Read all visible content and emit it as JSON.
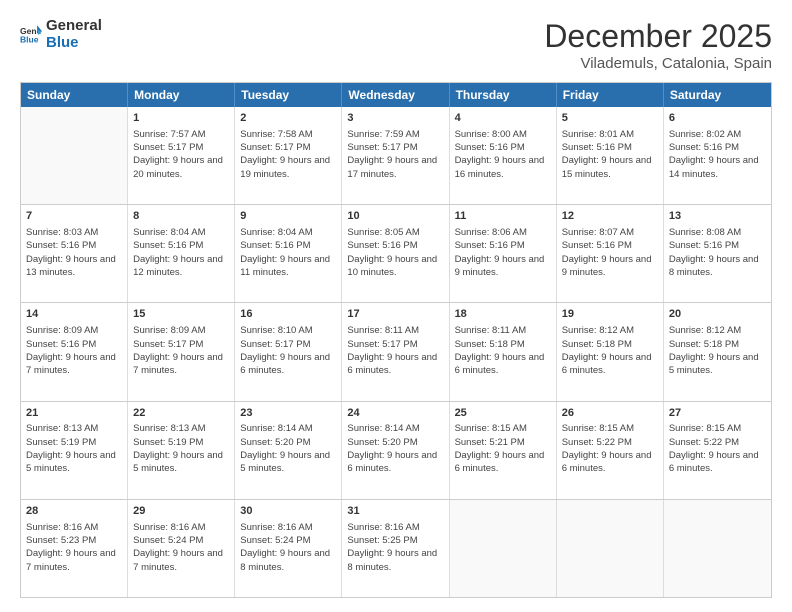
{
  "logo": {
    "text_general": "General",
    "text_blue": "Blue"
  },
  "title": "December 2025",
  "subtitle": "Vilademuls, Catalonia, Spain",
  "header_days": [
    "Sunday",
    "Monday",
    "Tuesday",
    "Wednesday",
    "Thursday",
    "Friday",
    "Saturday"
  ],
  "rows": [
    [
      {
        "day": "",
        "empty": true
      },
      {
        "day": "1",
        "sunrise": "7:57 AM",
        "sunset": "5:17 PM",
        "daylight": "9 hours and 20 minutes."
      },
      {
        "day": "2",
        "sunrise": "7:58 AM",
        "sunset": "5:17 PM",
        "daylight": "9 hours and 19 minutes."
      },
      {
        "day": "3",
        "sunrise": "7:59 AM",
        "sunset": "5:17 PM",
        "daylight": "9 hours and 17 minutes."
      },
      {
        "day": "4",
        "sunrise": "8:00 AM",
        "sunset": "5:16 PM",
        "daylight": "9 hours and 16 minutes."
      },
      {
        "day": "5",
        "sunrise": "8:01 AM",
        "sunset": "5:16 PM",
        "daylight": "9 hours and 15 minutes."
      },
      {
        "day": "6",
        "sunrise": "8:02 AM",
        "sunset": "5:16 PM",
        "daylight": "9 hours and 14 minutes."
      }
    ],
    [
      {
        "day": "7",
        "sunrise": "8:03 AM",
        "sunset": "5:16 PM",
        "daylight": "9 hours and 13 minutes."
      },
      {
        "day": "8",
        "sunrise": "8:04 AM",
        "sunset": "5:16 PM",
        "daylight": "9 hours and 12 minutes."
      },
      {
        "day": "9",
        "sunrise": "8:04 AM",
        "sunset": "5:16 PM",
        "daylight": "9 hours and 11 minutes."
      },
      {
        "day": "10",
        "sunrise": "8:05 AM",
        "sunset": "5:16 PM",
        "daylight": "9 hours and 10 minutes."
      },
      {
        "day": "11",
        "sunrise": "8:06 AM",
        "sunset": "5:16 PM",
        "daylight": "9 hours and 9 minutes."
      },
      {
        "day": "12",
        "sunrise": "8:07 AM",
        "sunset": "5:16 PM",
        "daylight": "9 hours and 9 minutes."
      },
      {
        "day": "13",
        "sunrise": "8:08 AM",
        "sunset": "5:16 PM",
        "daylight": "9 hours and 8 minutes."
      }
    ],
    [
      {
        "day": "14",
        "sunrise": "8:09 AM",
        "sunset": "5:16 PM",
        "daylight": "9 hours and 7 minutes."
      },
      {
        "day": "15",
        "sunrise": "8:09 AM",
        "sunset": "5:17 PM",
        "daylight": "9 hours and 7 minutes."
      },
      {
        "day": "16",
        "sunrise": "8:10 AM",
        "sunset": "5:17 PM",
        "daylight": "9 hours and 6 minutes."
      },
      {
        "day": "17",
        "sunrise": "8:11 AM",
        "sunset": "5:17 PM",
        "daylight": "9 hours and 6 minutes."
      },
      {
        "day": "18",
        "sunrise": "8:11 AM",
        "sunset": "5:18 PM",
        "daylight": "9 hours and 6 minutes."
      },
      {
        "day": "19",
        "sunrise": "8:12 AM",
        "sunset": "5:18 PM",
        "daylight": "9 hours and 6 minutes."
      },
      {
        "day": "20",
        "sunrise": "8:12 AM",
        "sunset": "5:18 PM",
        "daylight": "9 hours and 5 minutes."
      }
    ],
    [
      {
        "day": "21",
        "sunrise": "8:13 AM",
        "sunset": "5:19 PM",
        "daylight": "9 hours and 5 minutes."
      },
      {
        "day": "22",
        "sunrise": "8:13 AM",
        "sunset": "5:19 PM",
        "daylight": "9 hours and 5 minutes."
      },
      {
        "day": "23",
        "sunrise": "8:14 AM",
        "sunset": "5:20 PM",
        "daylight": "9 hours and 5 minutes."
      },
      {
        "day": "24",
        "sunrise": "8:14 AM",
        "sunset": "5:20 PM",
        "daylight": "9 hours and 6 minutes."
      },
      {
        "day": "25",
        "sunrise": "8:15 AM",
        "sunset": "5:21 PM",
        "daylight": "9 hours and 6 minutes."
      },
      {
        "day": "26",
        "sunrise": "8:15 AM",
        "sunset": "5:22 PM",
        "daylight": "9 hours and 6 minutes."
      },
      {
        "day": "27",
        "sunrise": "8:15 AM",
        "sunset": "5:22 PM",
        "daylight": "9 hours and 6 minutes."
      }
    ],
    [
      {
        "day": "28",
        "sunrise": "8:16 AM",
        "sunset": "5:23 PM",
        "daylight": "9 hours and 7 minutes."
      },
      {
        "day": "29",
        "sunrise": "8:16 AM",
        "sunset": "5:24 PM",
        "daylight": "9 hours and 7 minutes."
      },
      {
        "day": "30",
        "sunrise": "8:16 AM",
        "sunset": "5:24 PM",
        "daylight": "9 hours and 8 minutes."
      },
      {
        "day": "31",
        "sunrise": "8:16 AM",
        "sunset": "5:25 PM",
        "daylight": "9 hours and 8 minutes."
      },
      {
        "day": "",
        "empty": true
      },
      {
        "day": "",
        "empty": true
      },
      {
        "day": "",
        "empty": true
      }
    ]
  ],
  "labels": {
    "sunrise": "Sunrise:",
    "sunset": "Sunset:",
    "daylight": "Daylight:"
  }
}
